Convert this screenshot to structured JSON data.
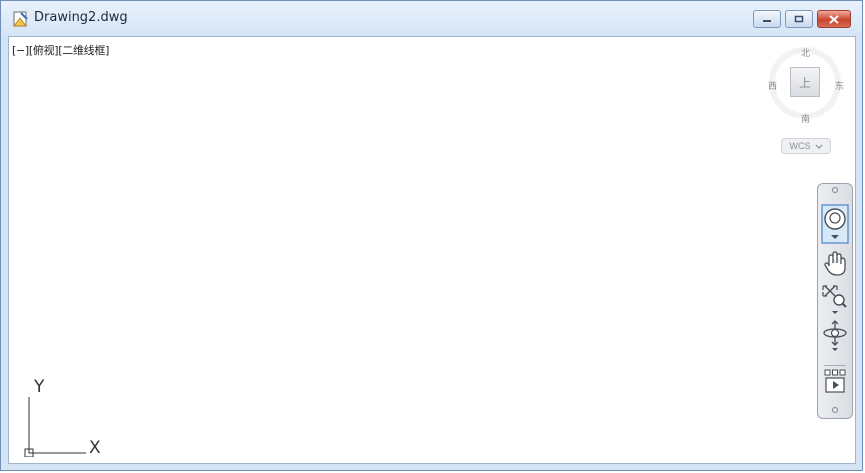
{
  "window": {
    "title": "Drawing2.dwg",
    "caption_buttons": [
      "minimize",
      "restore",
      "close"
    ]
  },
  "viewport": {
    "label": "[−][俯视][二维线框]"
  },
  "viewcube": {
    "north": "北",
    "south": "南",
    "east": "东",
    "west": "西",
    "face": "上",
    "wcs_label": "WCS"
  },
  "navigation_bar": {
    "tools": [
      "steering-wheel-icon",
      "pan-hand-icon",
      "zoom-icon",
      "orbit-icon",
      "showmotion-icon"
    ]
  },
  "ucs_icon": {
    "x_label": "X",
    "y_label": "Y"
  }
}
